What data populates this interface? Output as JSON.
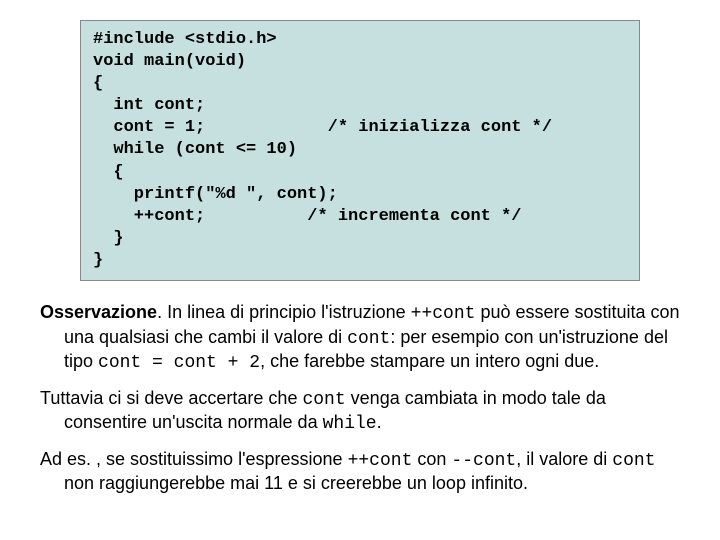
{
  "code": {
    "l1": "#include <stdio.h>",
    "l2": "void main(void)",
    "l3": "{",
    "l4": "  int cont;",
    "l5a": "  cont = 1;",
    "l5b": "/* inizializza cont */",
    "l6": "  while (cont <= 10)",
    "l7": "  {",
    "l8": "    printf(\"%d \", cont);",
    "l9a": "    ++cont;",
    "l9b": "/* incrementa cont */",
    "l10": "  }",
    "l11": "}"
  },
  "para1": {
    "lead": "Osservazione",
    "t1": ". In linea di principio l'istruzione ",
    "code1": "++cont",
    "t2": " può essere sostituita con una qualsiasi che cambi il valore di ",
    "code2": "cont",
    "t3": ": per esempio con un'istruzione del tipo ",
    "code3": "cont = cont + 2",
    "t4": ", che farebbe stampare un intero ogni due."
  },
  "para2": {
    "t1": "Tuttavia ci si deve accertare che ",
    "code1": "cont",
    "t2": " venga cambiata in modo tale da consentire un'uscita normale da ",
    "code2": "while",
    "t3": "."
  },
  "para3": {
    "t1": "Ad es. , se sostituissimo l'espressione ",
    "code1": "++cont",
    "t2": " con ",
    "code2": "--cont",
    "t3": ", il valore di ",
    "code3": "cont",
    "t4": " non raggiungerebbe mai 11 e si creerebbe un loop infinito."
  }
}
